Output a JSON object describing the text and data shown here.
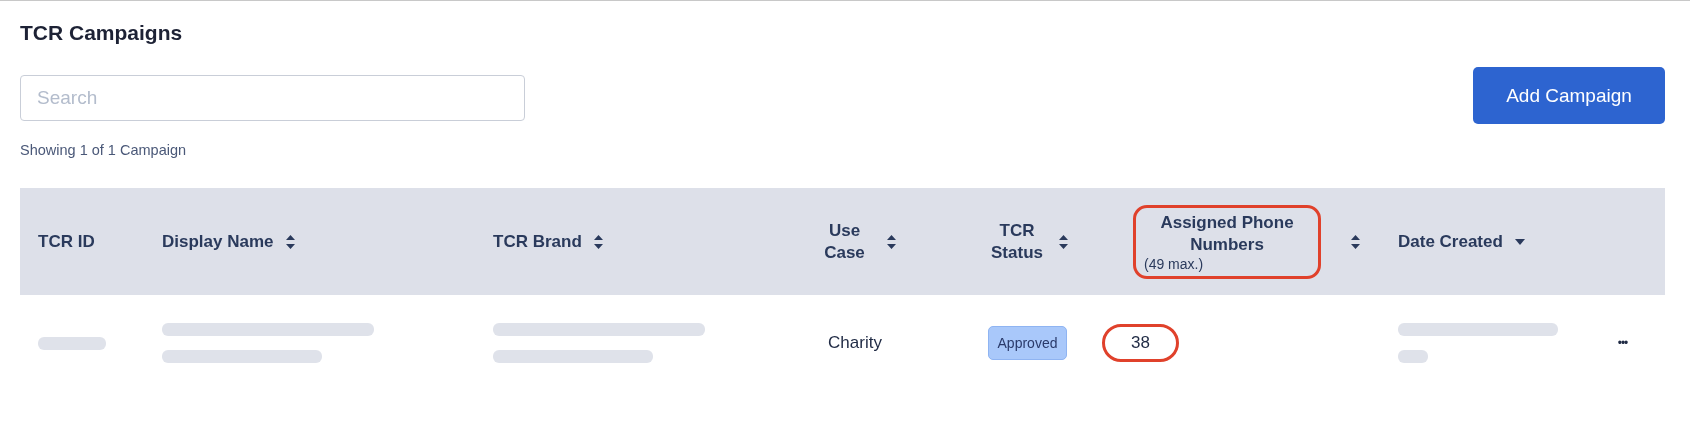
{
  "page": {
    "title": "TCR Campaigns"
  },
  "search": {
    "placeholder": "Search"
  },
  "add_button": "Add Campaign",
  "summary": "Showing 1 of 1 Campaign",
  "table": {
    "columns": [
      {
        "label": "TCR ID",
        "sortable": false
      },
      {
        "label": "Display Name",
        "sortable": true,
        "descending": false
      },
      {
        "label": "TCR Brand",
        "sortable": true,
        "descending": false
      },
      {
        "label": "Use Case",
        "sortable": true,
        "descending": false
      },
      {
        "label": "TCR Status",
        "sortable": true,
        "descending": false
      },
      {
        "label": "Assigned Phone Numbers",
        "note": "(49 max.)",
        "highlighted": true,
        "sortable": true,
        "descending": false
      },
      {
        "label": "Date Created",
        "sortable": true,
        "descending": true
      }
    ],
    "rows": [
      {
        "redacted": true,
        "use_case": "Charity",
        "status": "Approved",
        "assigned": "38",
        "assigned_highlighted": true,
        "menu": "•••"
      }
    ]
  }
}
